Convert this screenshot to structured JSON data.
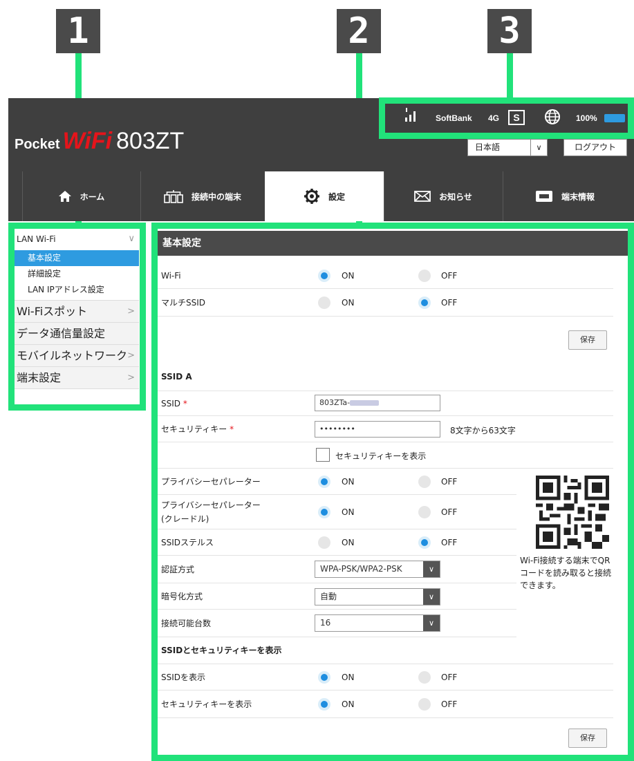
{
  "callouts": [
    "1",
    "2",
    "3"
  ],
  "logo": {
    "pocket": "Pocket",
    "wifi": "WiFi",
    "model": "803ZT"
  },
  "status": {
    "carrier": "SoftBank",
    "network": "4G",
    "sim": "S",
    "battery": "100%",
    "battery_color": "#2e9be0"
  },
  "header": {
    "language": "日本語",
    "logout": "ログアウト"
  },
  "tabs": [
    {
      "label": "ホーム",
      "icon": "home-icon"
    },
    {
      "label": "接続中の端末",
      "icon": "devices-icon"
    },
    {
      "label": "設定",
      "icon": "gear-icon",
      "active": true
    },
    {
      "label": "お知らせ",
      "icon": "mail-icon"
    },
    {
      "label": "端末情報",
      "icon": "device-info-icon"
    }
  ],
  "sidebar": {
    "group1": "LAN Wi-Fi",
    "sub": [
      "基本設定",
      "詳細設定",
      "LAN IPアドレス設定"
    ],
    "items": [
      "Wi-Fiスポット",
      "データ通信量設定",
      "モバイルネットワーク",
      "端末設定"
    ]
  },
  "main": {
    "title": "基本設定",
    "on": "ON",
    "off": "OFF",
    "wifi_label": "Wi-Fi",
    "multi_ssid_label": "マルチSSID",
    "save": "保存",
    "ssid_a": "SSID A",
    "ssid_label": "SSID",
    "required": "*",
    "ssid_value": "803ZTa-",
    "key_label": "セキュリティキー",
    "key_value": "••••••••",
    "key_hint": "8文字から63文字",
    "show_key": "セキュリティキーを表示",
    "privacy_label": "プライバシーセパレーター",
    "privacy_cradle_label": "プライバシーセパレーター",
    "privacy_cradle_label2": "(クレードル)",
    "stealth_label": "SSIDステルス",
    "auth_label": "認証方式",
    "auth_value": "WPA-PSK/WPA2-PSK",
    "enc_label": "暗号化方式",
    "enc_value": "自動",
    "max_label": "接続可能台数",
    "max_value": "16",
    "qr_note": "Wi-Fi接続する端末でQRコードを読み取ると接続できます。",
    "display_section": "SSIDとセキュリティキーを表示",
    "show_ssid_label": "SSIDを表示",
    "show_key_label": "セキュリティキーを表示"
  },
  "colors": {
    "highlight": "#21e27a",
    "dark": "#3f3f3f",
    "accent": "#1e8ee0",
    "brand_red": "#e5141b"
  }
}
